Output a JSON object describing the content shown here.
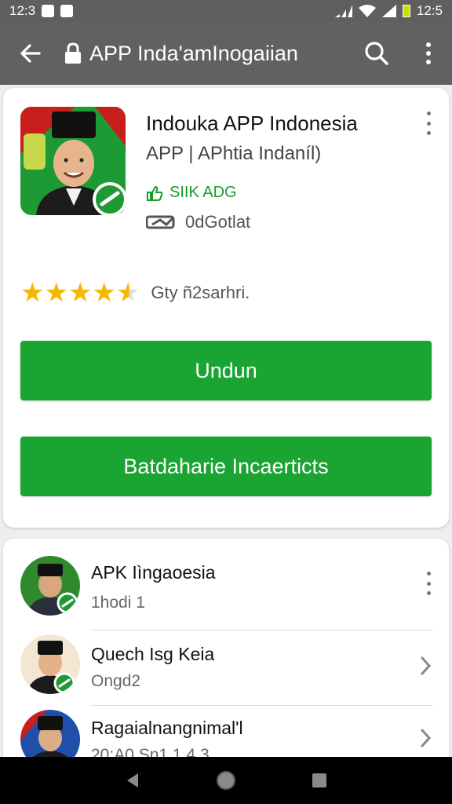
{
  "status_bar": {
    "time_left": "12:3",
    "time_right": "12:5"
  },
  "app_bar": {
    "title": "APP Inda'amInogaiian"
  },
  "app": {
    "name": "Indouka APP Indonesia",
    "subtitle": "APP | APhtia Indaníl)",
    "badge": "SIIK ADG",
    "info": "0dGotlat",
    "rating_text": "Gty ñ2sarhri.",
    "rating": 4.5,
    "download_label": "Undun",
    "secondary_label": "Batdaharie Incaerticts"
  },
  "list": [
    {
      "title": "APK Iìngaoesia",
      "sub": "1hodi 1",
      "action": "more-vert-icon"
    },
    {
      "title": "Quech Isg Keia",
      "sub": "Ongd2",
      "action": "chevron-right-icon"
    },
    {
      "title": "Ragaialnangnimal'l",
      "sub": "20:A0 Sn1 1 4.3",
      "action": "chevron-right-icon"
    }
  ],
  "colors": {
    "accent": "#1aa532",
    "app_bar": "#616161",
    "status_bar": "#5f5f5f",
    "star": "#f5b800"
  }
}
